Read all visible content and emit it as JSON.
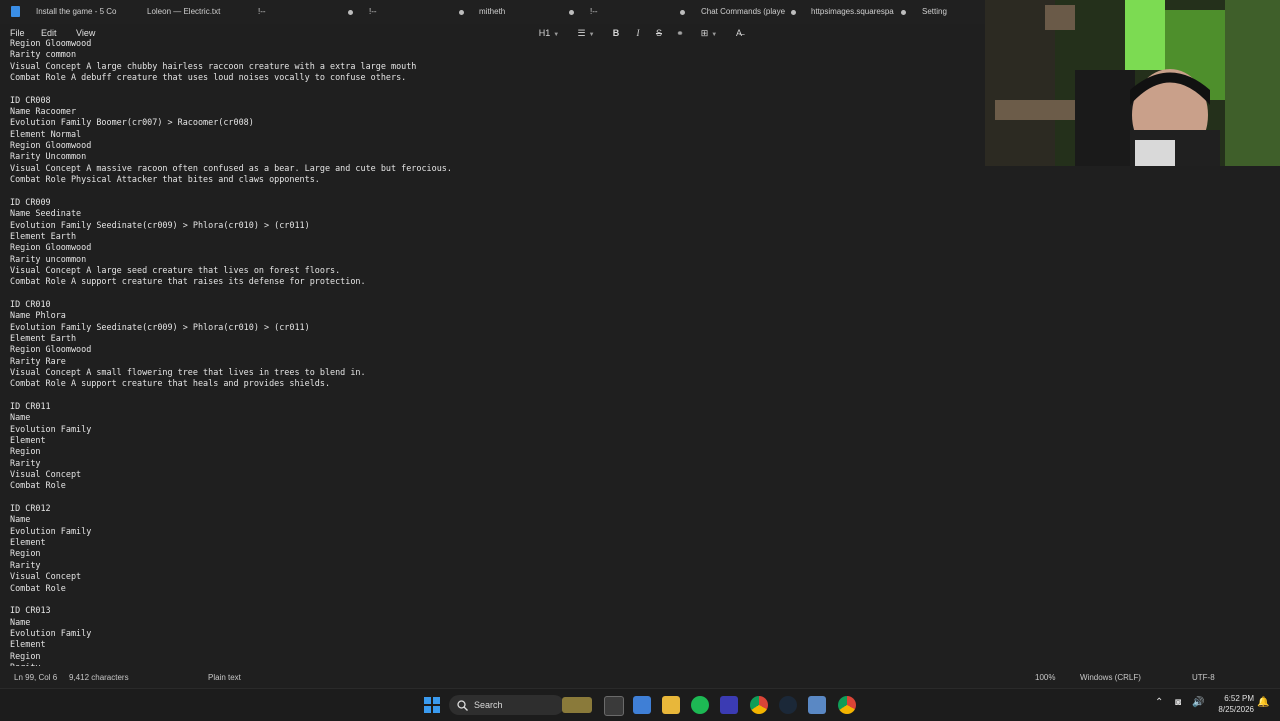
{
  "tabs": [
    {
      "label": "Install the game - 5 Co"
    },
    {
      "label": "Loleon — Electric.txt"
    },
    {
      "label": "!--"
    },
    {
      "label": "!--"
    },
    {
      "label": "mitheth"
    },
    {
      "label": "!--"
    },
    {
      "label": "Chat Commands (playe"
    },
    {
      "label": "httpsimages.squarespa"
    },
    {
      "label": "Setting"
    }
  ],
  "menu": {
    "file": "File",
    "edit": "Edit",
    "view": "View"
  },
  "toolbar": {
    "heading": "H1",
    "bold": "B",
    "italic": "I",
    "strike": "S"
  },
  "document_text": "Region Gloomwood\nRarity common\nVisual Concept A large chubby hairless raccoon creature with a extra large mouth\nCombat Role A debuff creature that uses loud noises vocally to confuse others.\n\nID CR008\nName Racoomer\nEvolution Family Boomer(cr007) > Racoomer(cr008)\nElement Normal\nRegion Gloomwood\nRarity Uncommon\nVisual Concept A massive racoon often confused as a bear. Large and cute but ferocious.\nCombat Role Physical Attacker that bites and claws opponents.\n\nID CR009\nName Seedinate\nEvolution Family Seedinate(cr009) > Phlora(cr010) > (cr011)\nElement Earth\nRegion Gloomwood\nRarity uncommon\nVisual Concept A large seed creature that lives on forest floors.\nCombat Role A support creature that raises its defense for protection.\n\nID CR010\nName Phlora\nEvolution Family Seedinate(cr009) > Phlora(cr010) > (cr011)\nElement Earth\nRegion Gloomwood\nRarity Rare\nVisual Concept A small flowering tree that lives in trees to blend in.\nCombat Role A support creature that heals and provides shields.\n\nID CR011\nName\nEvolution Family\nElement\nRegion\nRarity\nVisual Concept\nCombat Role\n\nID CR012\nName\nEvolution Family\nElement\nRegion\nRarity\nVisual Concept\nCombat Role\n\nID CR013\nName\nEvolution Family\nElement\nRegion\nRarity",
  "status": {
    "position": "Ln 99, Col 6",
    "characters": "9,412 characters",
    "format": "Plain text",
    "zoom": "100%",
    "line_ending": "Windows (CRLF)",
    "encoding": "UTF-8"
  },
  "taskbar": {
    "search_label": "Search",
    "time": "6:52 PM",
    "date": "8/25/2026"
  },
  "icons": [
    "notepad-icon",
    "windows-start-icon",
    "search-icon",
    "file-explorer-icon",
    "spotify-icon",
    "chrome-icon",
    "steam-icon",
    "wifi-icon",
    "volume-icon",
    "battery-icon",
    "bell-icon"
  ],
  "colors": {
    "background": "#1f1f1f",
    "accent": "#3a8ee6",
    "text": "#e4e4e4"
  }
}
